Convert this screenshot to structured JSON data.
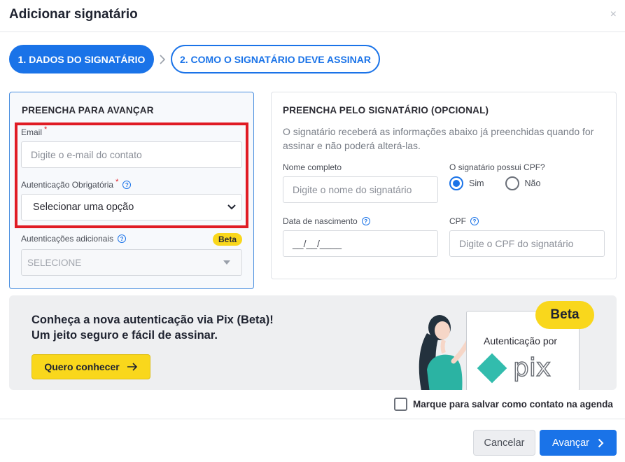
{
  "modal": {
    "title": "Adicionar signatário",
    "close_glyph": "×"
  },
  "steps": [
    {
      "label": "1. DADOS DO SIGNATÁRIO",
      "state": "active"
    },
    {
      "label": "2. COMO O SIGNATÁRIO DEVE ASSINAR",
      "state": "inactive"
    }
  ],
  "left_card": {
    "heading": "PREENCHA PARA AVANÇAR",
    "email_label": "Email",
    "required_mark": "*",
    "email_placeholder": "Digite o e-mail do contato",
    "auth_label": "Autenticação Obrigatória",
    "auth_selected": "Selecionar uma opção",
    "extra_auth_label": "Autenticações adicionais",
    "extra_auth_badge": "Beta",
    "extra_auth_selected": "SELECIONE",
    "help_glyph": "?"
  },
  "right_card": {
    "heading": "PREENCHA PELO SIGNATÁRIO (OPCIONAL)",
    "description": "O signatário receberá as informações abaixo já preenchidas quando for assinar e não poderá alterá-las.",
    "name_label": "Nome completo",
    "name_placeholder": "Digite o nome do signatário",
    "cpf_question": "O signatário possui CPF?",
    "radio_yes": "Sim",
    "radio_no": "Não",
    "radio_selected": "Sim",
    "dob_label": "Data de nascimento",
    "dob_placeholder": "__/__/____",
    "cpf_label": "CPF",
    "cpf_placeholder": "Digite o CPF do signatário"
  },
  "banner": {
    "line1": "Conheça a nova autenticação via Pix (Beta)!",
    "line2": "Um jeito seguro e fácil de assinar.",
    "button": "Quero conhecer",
    "card_text": "Autenticação por",
    "logo_text": "pix",
    "badge": "Beta"
  },
  "save_contact_label": "Marque para salvar como contato na agenda",
  "footer": {
    "cancel": "Cancelar",
    "next": "Avançar"
  },
  "colors": {
    "primary": "#1a73e8",
    "highlight_box": "#e01b24",
    "beta_yellow": "#f9d71c",
    "pix_teal": "#32bcad"
  }
}
